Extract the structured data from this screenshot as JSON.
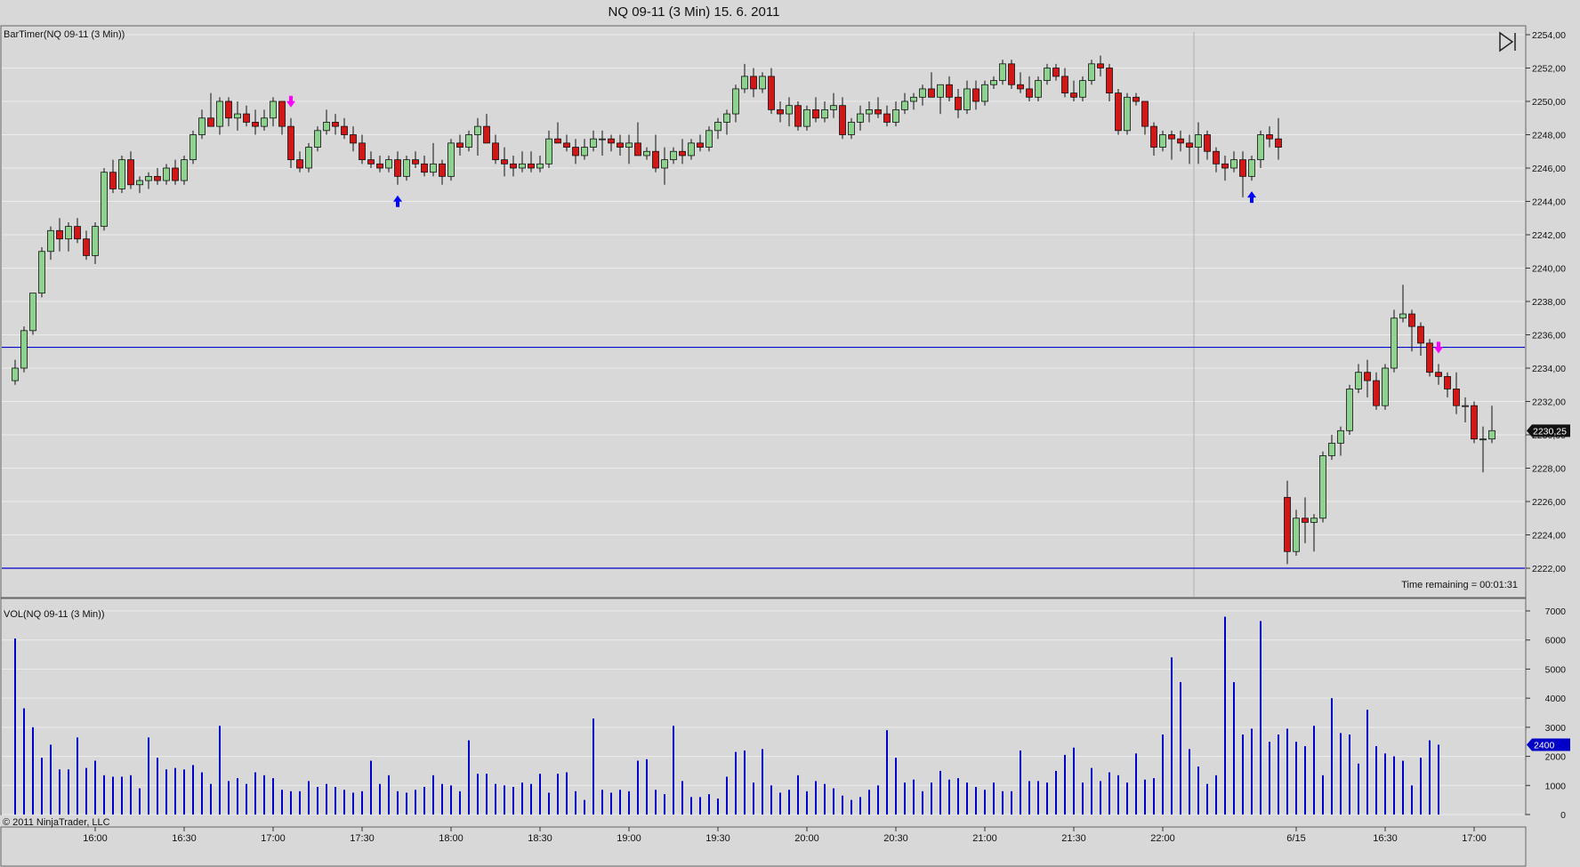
{
  "title": "NQ 09-11 (3 Min)  15. 6. 2011",
  "price_panel_label": "BarTimer(NQ 09-11 (3 Min))",
  "volume_panel_label": "VOL(NQ 09-11 (3 Min))",
  "time_remaining": "Time remaining = 00:01:31",
  "copyright": "© 2011 NinjaTrader, LLC",
  "last_price_label": "2230,25",
  "last_volume_label": "2400",
  "colors": {
    "background": "#d8d8d8",
    "up": "#8fd18f",
    "down": "#d01818",
    "volume": "#0000c8",
    "hline": "#0000cc",
    "signal_buy": "#0000ff",
    "signal_sell": "#ff00ff"
  },
  "chart_data": [
    {
      "type": "candlestick",
      "title": "NQ 09-11 (3 Min)  15. 6. 2011",
      "y_tick_labels": [
        "2222,00",
        "2224,00",
        "2226,00",
        "2228,00",
        "2230,00",
        "2232,00",
        "2234,00",
        "2236,00",
        "2238,00",
        "2240,00",
        "2242,00",
        "2244,00",
        "2246,00",
        "2248,00",
        "2250,00",
        "2252,00",
        "2254,00"
      ],
      "ylim": [
        2221,
        2254.5
      ],
      "x_tick_labels": [
        "16:00",
        "16:30",
        "17:00",
        "17:30",
        "18:00",
        "18:30",
        "19:00",
        "19:30",
        "20:00",
        "20:30",
        "21:00",
        "21:30",
        "22:00",
        "6/15",
        "16:30",
        "17:00"
      ],
      "horizontal_lines": [
        2235.25,
        2222.0
      ],
      "session_break_index": 133,
      "ohlc": [
        [
          2233.25,
          2234.5,
          2233.0,
          2234.0
        ],
        [
          2234.0,
          2236.5,
          2233.75,
          2236.25
        ],
        [
          2236.25,
          2238.5,
          2236.0,
          2238.5
        ],
        [
          2238.5,
          2241.25,
          2238.25,
          2241.0
        ],
        [
          2241.0,
          2242.5,
          2240.5,
          2242.25
        ],
        [
          2242.25,
          2243.0,
          2241.0,
          2241.75
        ],
        [
          2241.75,
          2242.75,
          2241.0,
          2242.5
        ],
        [
          2242.5,
          2243.0,
          2241.5,
          2241.75
        ],
        [
          2241.75,
          2242.25,
          2240.5,
          2240.75
        ],
        [
          2240.75,
          2242.75,
          2240.25,
          2242.5
        ],
        [
          2242.5,
          2246.0,
          2242.25,
          2245.75
        ],
        [
          2245.75,
          2246.5,
          2244.5,
          2244.75
        ],
        [
          2244.75,
          2246.75,
          2244.5,
          2246.5
        ],
        [
          2246.5,
          2247.0,
          2244.75,
          2245.0
        ],
        [
          2245.0,
          2245.5,
          2244.5,
          2245.25
        ],
        [
          2245.25,
          2245.75,
          2244.75,
          2245.5
        ],
        [
          2245.5,
          2246.0,
          2245.0,
          2245.25
        ],
        [
          2245.25,
          2246.25,
          2245.0,
          2246.0
        ],
        [
          2246.0,
          2246.5,
          2245.0,
          2245.25
        ],
        [
          2245.25,
          2246.75,
          2245.0,
          2246.5
        ],
        [
          2246.5,
          2248.25,
          2246.25,
          2248.0
        ],
        [
          2248.0,
          2249.5,
          2247.75,
          2249.0
        ],
        [
          2249.0,
          2250.5,
          2248.75,
          2248.5
        ],
        [
          2248.5,
          2250.25,
          2248.0,
          2250.0
        ],
        [
          2250.0,
          2250.25,
          2248.5,
          2249.0
        ],
        [
          2249.0,
          2250.0,
          2248.25,
          2249.25
        ],
        [
          2249.25,
          2249.75,
          2248.5,
          2248.75
        ],
        [
          2248.75,
          2249.5,
          2248.0,
          2248.5
        ],
        [
          2248.5,
          2249.5,
          2248.25,
          2249.0
        ],
        [
          2249.0,
          2250.25,
          2248.5,
          2250.0
        ],
        [
          2250.0,
          2250.0,
          2248.0,
          2248.5
        ],
        [
          2248.5,
          2249.0,
          2246.0,
          2246.5
        ],
        [
          2246.5,
          2247.0,
          2245.75,
          2246.0
        ],
        [
          2246.0,
          2247.5,
          2245.75,
          2247.25
        ],
        [
          2247.25,
          2248.5,
          2247.0,
          2248.25
        ],
        [
          2248.25,
          2249.5,
          2248.0,
          2248.75
        ],
        [
          2248.75,
          2249.25,
          2248.0,
          2248.5
        ],
        [
          2248.5,
          2249.0,
          2247.75,
          2248.0
        ],
        [
          2248.0,
          2248.5,
          2247.0,
          2247.5
        ],
        [
          2247.5,
          2248.0,
          2246.25,
          2246.5
        ],
        [
          2246.5,
          2247.0,
          2246.0,
          2246.25
        ],
        [
          2246.25,
          2246.75,
          2245.75,
          2246.0
        ],
        [
          2246.0,
          2246.75,
          2245.75,
          2246.5
        ],
        [
          2246.5,
          2247.0,
          2245.0,
          2245.5
        ],
        [
          2245.5,
          2246.75,
          2245.25,
          2246.5
        ],
        [
          2246.5,
          2247.0,
          2246.0,
          2246.25
        ],
        [
          2246.25,
          2246.75,
          2245.5,
          2245.75
        ],
        [
          2245.75,
          2247.5,
          2245.5,
          2246.25
        ],
        [
          2246.25,
          2246.5,
          2245.0,
          2245.5
        ],
        [
          2245.5,
          2247.75,
          2245.25,
          2247.5
        ],
        [
          2247.5,
          2248.0,
          2246.75,
          2247.25
        ],
        [
          2247.25,
          2248.25,
          2247.0,
          2248.0
        ],
        [
          2248.0,
          2249.0,
          2246.75,
          2248.5
        ],
        [
          2248.5,
          2249.25,
          2247.75,
          2247.5
        ],
        [
          2247.5,
          2248.0,
          2246.25,
          2246.5
        ],
        [
          2246.5,
          2247.25,
          2245.5,
          2246.25
        ],
        [
          2246.25,
          2246.75,
          2245.5,
          2246.0
        ],
        [
          2246.0,
          2247.0,
          2245.75,
          2246.25
        ],
        [
          2246.25,
          2247.0,
          2245.75,
          2246.0
        ],
        [
          2246.0,
          2246.75,
          2245.75,
          2246.25
        ],
        [
          2246.25,
          2248.25,
          2246.0,
          2247.75
        ],
        [
          2247.75,
          2248.75,
          2247.5,
          2247.5
        ],
        [
          2247.5,
          2248.0,
          2247.0,
          2247.25
        ],
        [
          2247.25,
          2247.75,
          2246.25,
          2246.75
        ],
        [
          2246.75,
          2247.75,
          2246.5,
          2247.25
        ],
        [
          2247.25,
          2248.25,
          2247.0,
          2247.75
        ],
        [
          2247.75,
          2248.25,
          2246.75,
          2247.75
        ],
        [
          2247.75,
          2248.0,
          2247.0,
          2247.5
        ],
        [
          2247.5,
          2248.0,
          2246.75,
          2247.25
        ],
        [
          2247.25,
          2248.0,
          2246.25,
          2247.5
        ],
        [
          2247.5,
          2248.75,
          2247.0,
          2246.75
        ],
        [
          2246.75,
          2247.25,
          2246.5,
          2247.0
        ],
        [
          2247.0,
          2248.0,
          2245.75,
          2246.0
        ],
        [
          2246.0,
          2247.25,
          2245.0,
          2246.5
        ],
        [
          2246.5,
          2247.25,
          2246.25,
          2247.0
        ],
        [
          2247.0,
          2247.75,
          2246.25,
          2246.75
        ],
        [
          2246.75,
          2247.75,
          2246.5,
          2247.5
        ],
        [
          2247.5,
          2248.0,
          2247.0,
          2247.25
        ],
        [
          2247.25,
          2248.5,
          2247.0,
          2248.25
        ],
        [
          2248.25,
          2249.0,
          2247.75,
          2248.75
        ],
        [
          2248.75,
          2249.5,
          2248.0,
          2249.25
        ],
        [
          2249.25,
          2251.0,
          2248.75,
          2250.75
        ],
        [
          2250.75,
          2252.25,
          2250.5,
          2251.5
        ],
        [
          2251.5,
          2252.0,
          2250.25,
          2250.75
        ],
        [
          2250.75,
          2251.75,
          2250.5,
          2251.5
        ],
        [
          2251.5,
          2252.0,
          2249.25,
          2249.5
        ],
        [
          2249.5,
          2250.0,
          2248.75,
          2249.25
        ],
        [
          2249.25,
          2250.25,
          2248.5,
          2249.75
        ],
        [
          2249.75,
          2250.0,
          2248.25,
          2248.5
        ],
        [
          2248.5,
          2249.75,
          2248.25,
          2249.5
        ],
        [
          2249.5,
          2250.25,
          2248.75,
          2249.0
        ],
        [
          2249.0,
          2250.0,
          2248.75,
          2249.5
        ],
        [
          2249.5,
          2250.5,
          2249.0,
          2249.75
        ],
        [
          2249.75,
          2250.25,
          2247.75,
          2248.0
        ],
        [
          2248.0,
          2249.0,
          2247.75,
          2248.75
        ],
        [
          2248.75,
          2249.75,
          2248.25,
          2249.25
        ],
        [
          2249.25,
          2250.0,
          2248.75,
          2249.5
        ],
        [
          2249.5,
          2250.25,
          2249.0,
          2249.25
        ],
        [
          2249.25,
          2249.75,
          2248.5,
          2248.75
        ],
        [
          2248.75,
          2250.0,
          2248.5,
          2249.5
        ],
        [
          2249.5,
          2250.5,
          2249.25,
          2250.0
        ],
        [
          2250.0,
          2250.5,
          2249.5,
          2250.25
        ],
        [
          2250.25,
          2251.0,
          2249.75,
          2250.75
        ],
        [
          2250.75,
          2251.75,
          2250.25,
          2250.25
        ],
        [
          2250.25,
          2251.0,
          2249.25,
          2251.0
        ],
        [
          2251.0,
          2251.5,
          2250.0,
          2250.25
        ],
        [
          2250.25,
          2250.75,
          2249.0,
          2249.5
        ],
        [
          2249.5,
          2251.25,
          2249.25,
          2250.75
        ],
        [
          2250.75,
          2251.25,
          2249.5,
          2250.0
        ],
        [
          2250.0,
          2251.25,
          2249.75,
          2251.0
        ],
        [
          2251.0,
          2251.5,
          2250.75,
          2251.25
        ],
        [
          2251.25,
          2252.5,
          2251.0,
          2252.25
        ],
        [
          2252.25,
          2252.5,
          2250.75,
          2251.0
        ],
        [
          2251.0,
          2251.75,
          2250.5,
          2250.75
        ],
        [
          2250.75,
          2251.5,
          2250.0,
          2250.25
        ],
        [
          2250.25,
          2251.5,
          2250.0,
          2251.25
        ],
        [
          2251.25,
          2252.25,
          2251.0,
          2252.0
        ],
        [
          2252.0,
          2252.25,
          2251.25,
          2251.5
        ],
        [
          2251.5,
          2252.0,
          2250.25,
          2250.5
        ],
        [
          2250.5,
          2251.25,
          2250.0,
          2250.25
        ],
        [
          2250.25,
          2251.5,
          2250.0,
          2251.25
        ],
        [
          2251.25,
          2252.5,
          2251.0,
          2252.25
        ],
        [
          2252.25,
          2252.75,
          2251.5,
          2252.0
        ],
        [
          2252.0,
          2252.25,
          2250.0,
          2250.5
        ],
        [
          2250.5,
          2250.75,
          2248.0,
          2248.25
        ],
        [
          2248.25,
          2250.5,
          2248.0,
          2250.25
        ],
        [
          2250.25,
          2250.5,
          2249.75,
          2250.0
        ],
        [
          2250.0,
          2250.0,
          2248.0,
          2248.5
        ],
        [
          2248.5,
          2248.75,
          2246.75,
          2247.25
        ],
        [
          2247.25,
          2248.25,
          2247.0,
          2248.0
        ],
        [
          2248.0,
          2248.25,
          2246.5,
          2247.75
        ],
        [
          2247.75,
          2248.25,
          2247.0,
          2247.5
        ],
        [
          2247.5,
          2248.0,
          2246.25,
          2247.25
        ],
        [
          2247.25,
          2248.75,
          2246.25,
          2248.0
        ],
        [
          2248.0,
          2248.25,
          2246.5,
          2247.0
        ],
        [
          2247.0,
          2247.25,
          2245.75,
          2246.25
        ],
        [
          2246.25,
          2246.75,
          2245.25,
          2246.0
        ],
        [
          2246.0,
          2247.0,
          2245.75,
          2246.5
        ],
        [
          2246.5,
          2247.0,
          2244.25,
          2245.5
        ],
        [
          2245.5,
          2246.75,
          2245.25,
          2246.5
        ],
        [
          2246.5,
          2248.25,
          2246.0,
          2248.0
        ],
        [
          2248.0,
          2248.5,
          2247.25,
          2247.75
        ],
        [
          2247.75,
          2249.0,
          2246.5,
          2247.25
        ],
        [
          2226.25,
          2227.25,
          2222.25,
          2223.0
        ],
        [
          2223.0,
          2225.5,
          2222.75,
          2225.0
        ],
        [
          2225.0,
          2226.25,
          2223.5,
          2224.75
        ],
        [
          2224.75,
          2225.25,
          2223.0,
          2225.0
        ],
        [
          2225.0,
          2229.0,
          2224.75,
          2228.75
        ],
        [
          2228.75,
          2230.0,
          2228.5,
          2229.5
        ],
        [
          2229.5,
          2230.5,
          2228.75,
          2230.25
        ],
        [
          2230.25,
          2233.0,
          2230.0,
          2232.75
        ],
        [
          2232.75,
          2234.25,
          2232.5,
          2233.75
        ],
        [
          2233.75,
          2234.5,
          2232.25,
          2233.25
        ],
        [
          2233.25,
          2233.75,
          2231.5,
          2231.75
        ],
        [
          2231.75,
          2234.25,
          2231.5,
          2234.0
        ],
        [
          2234.0,
          2237.5,
          2233.75,
          2237.0
        ],
        [
          2237.0,
          2239.0,
          2236.75,
          2237.25
        ],
        [
          2237.25,
          2237.5,
          2235.0,
          2236.5
        ],
        [
          2236.5,
          2236.75,
          2234.75,
          2235.5
        ],
        [
          2235.5,
          2235.75,
          2233.5,
          2233.75
        ],
        [
          2233.75,
          2234.25,
          2233.0,
          2233.5
        ],
        [
          2233.5,
          2233.75,
          2232.25,
          2232.75
        ],
        [
          2232.75,
          2233.75,
          2231.25,
          2231.75
        ],
        [
          2231.75,
          2232.25,
          2230.75,
          2231.75
        ],
        [
          2231.75,
          2232.0,
          2229.5,
          2229.75
        ],
        [
          2229.75,
          2230.5,
          2227.75,
          2229.75
        ],
        [
          2229.75,
          2231.75,
          2229.5,
          2230.25
        ]
      ],
      "signals": [
        {
          "bar": 31,
          "type": "sell"
        },
        {
          "bar": 43,
          "type": "buy"
        },
        {
          "bar": 139,
          "type": "buy"
        },
        {
          "bar": 160,
          "type": "sell"
        }
      ]
    },
    {
      "type": "bar",
      "title": "VOL(NQ 09-11 (3 Min))",
      "y_tick_labels": [
        "0",
        "1000",
        "2000",
        "3000",
        "4000",
        "5000",
        "6000",
        "7000"
      ],
      "ylim": [
        0,
        7200
      ],
      "values": [
        6050,
        3650,
        3000,
        1950,
        2400,
        1550,
        1550,
        2650,
        1600,
        1850,
        1350,
        1300,
        1300,
        1350,
        900,
        2650,
        1950,
        1550,
        1600,
        1550,
        1700,
        1450,
        1050,
        3050,
        1150,
        1250,
        1050,
        1450,
        1350,
        1250,
        850,
        800,
        800,
        1150,
        950,
        1050,
        950,
        850,
        750,
        800,
        1850,
        1050,
        1350,
        800,
        750,
        850,
        950,
        1350,
        1050,
        1000,
        800,
        2550,
        1400,
        1400,
        1050,
        1000,
        950,
        1100,
        1050,
        1400,
        750,
        1400,
        1450,
        800,
        500,
        3300,
        850,
        750,
        850,
        800,
        1850,
        1900,
        850,
        700,
        3050,
        1150,
        600,
        600,
        700,
        550,
        1300,
        2150,
        2200,
        1100,
        2250,
        1000,
        750,
        850,
        1350,
        800,
        1150,
        1050,
        900,
        650,
        500,
        600,
        850,
        1000,
        2900,
        1950,
        1100,
        1200,
        800,
        1100,
        1500,
        1200,
        1250,
        1100,
        950,
        850,
        1100,
        800,
        800,
        2200,
        1150,
        1150,
        1100,
        1500,
        2050,
        2300,
        1100,
        1600,
        1150,
        1450,
        1350,
        1100,
        2100,
        1200,
        1250,
        2750,
        5400,
        4550,
        2250,
        1650,
        1050,
        1350,
        6800,
        4550,
        2750,
        2950,
        6650,
        2500,
        2750,
        2950,
        2500,
        2350,
        3050,
        1350,
        4000,
        2800,
        2750,
        1750,
        3600,
        2350,
        2100,
        2000,
        1850,
        1000,
        1950,
        2550,
        2400
      ]
    }
  ]
}
